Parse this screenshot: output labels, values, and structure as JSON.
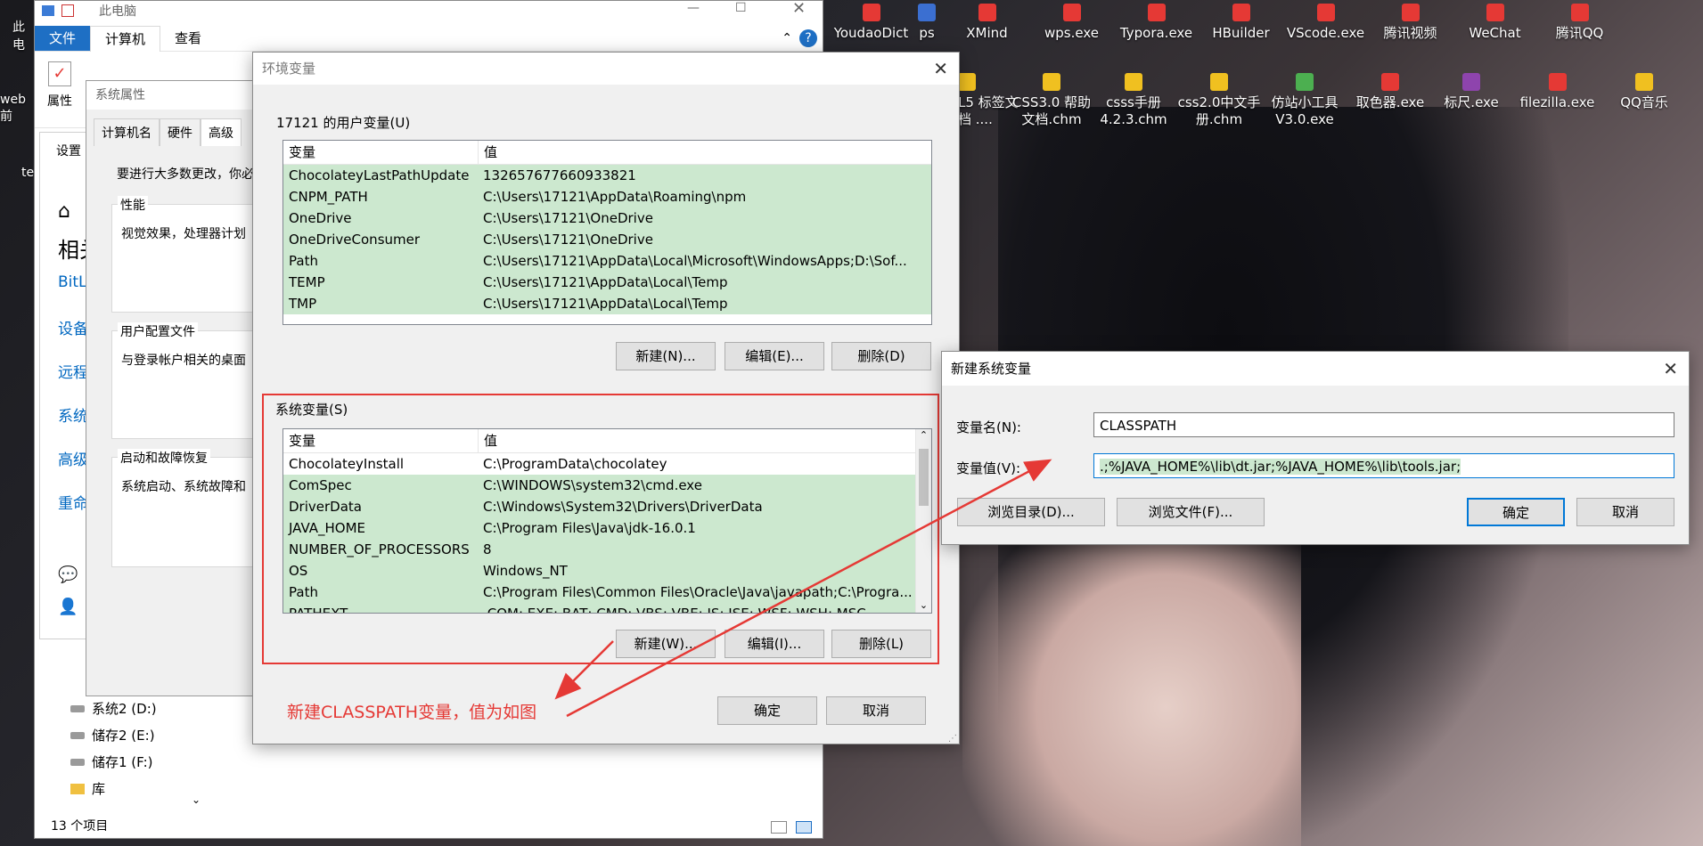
{
  "desktop": {
    "icons": [
      {
        "label": "YoudaoDict",
        "color": "#e53935"
      },
      {
        "label": "ps",
        "color": "#3b6fd1"
      },
      {
        "label": "XMind",
        "color": "#e53935"
      },
      {
        "label": "wps.exe",
        "color": "#e53935"
      },
      {
        "label": "Typora.exe",
        "color": "#e53935"
      },
      {
        "label": "HBuilder",
        "color": "#e53935"
      },
      {
        "label": "VScode.exe",
        "color": "#e53935"
      },
      {
        "label": "腾讯视频",
        "color": "#e53935"
      },
      {
        "label": "WeChat",
        "color": "#e53935"
      },
      {
        "label": "腾讯QQ",
        "color": "#e53935"
      }
    ],
    "icons_row2": [
      {
        "label": "L5 标签文档 ....",
        "color": "#f0c020"
      },
      {
        "label": "CSS3.0 帮助文档.chm",
        "color": "#f0c020"
      },
      {
        "label": "csss手册4.2.3.chm",
        "color": "#f0c020"
      },
      {
        "label": "css2.0中文手册.chm",
        "color": "#f0c020"
      },
      {
        "label": "仿站小工具V3.0.exe",
        "color": "#4caf50"
      },
      {
        "label": "取色器.exe",
        "color": "#e53935"
      },
      {
        "label": "标尺.exe",
        "color": "#8e44ad"
      },
      {
        "label": "filezilla.exe",
        "color": "#e53935"
      },
      {
        "label": "QQ音乐",
        "color": "#f0c020"
      }
    ],
    "left_labels": [
      "此电",
      "web前",
      "te"
    ]
  },
  "explorer": {
    "title": "此电脑",
    "tabs": [
      "文件",
      "计算机",
      "查看"
    ],
    "ribbon_button": "属性",
    "nav": [
      "系统2 (D:)",
      "储存2 (E:)",
      "储存1 (F:)",
      "库"
    ],
    "status": "13 个项目"
  },
  "settings": {
    "label": "设置",
    "items": [
      "相关",
      "BitLo",
      "设备",
      "远程",
      "系统",
      "高级",
      "重命"
    ]
  },
  "sysprops": {
    "title": "系统属性",
    "tabs": [
      "计算机名",
      "硬件",
      "高级"
    ],
    "intro": "要进行大多数更改，你必",
    "groups": [
      {
        "label": "性能",
        "text": "视觉效果，处理器计划"
      },
      {
        "label": "用户配置文件",
        "text": "与登录帐户相关的桌面"
      },
      {
        "label": "启动和故障恢复",
        "text": "系统启动、系统故障和"
      }
    ]
  },
  "env": {
    "title": "环境变量",
    "user_label": "17121 的用户变量(U)",
    "col_var": "变量",
    "col_val": "值",
    "user_vars": [
      {
        "name": "ChocolateyLastPathUpdate",
        "value": "132657677660933821"
      },
      {
        "name": "CNPM_PATH",
        "value": "C:\\Users\\17121\\AppData\\Roaming\\npm"
      },
      {
        "name": "OneDrive",
        "value": "C:\\Users\\17121\\OneDrive"
      },
      {
        "name": "OneDriveConsumer",
        "value": "C:\\Users\\17121\\OneDrive"
      },
      {
        "name": "Path",
        "value": "C:\\Users\\17121\\AppData\\Local\\Microsoft\\WindowsApps;D:\\Sof..."
      },
      {
        "name": "TEMP",
        "value": "C:\\Users\\17121\\AppData\\Local\\Temp"
      },
      {
        "name": "TMP",
        "value": "C:\\Users\\17121\\AppData\\Local\\Temp"
      }
    ],
    "user_buttons": [
      "新建(N)...",
      "编辑(E)...",
      "删除(D)"
    ],
    "sys_label": "系统变量(S)",
    "sys_vars": [
      {
        "name": "ChocolateyInstall",
        "value": "C:\\ProgramData\\chocolatey"
      },
      {
        "name": "ComSpec",
        "value": "C:\\WINDOWS\\system32\\cmd.exe"
      },
      {
        "name": "DriverData",
        "value": "C:\\Windows\\System32\\Drivers\\DriverData"
      },
      {
        "name": "JAVA_HOME",
        "value": "C:\\Program Files\\Java\\jdk-16.0.1"
      },
      {
        "name": "NUMBER_OF_PROCESSORS",
        "value": "8"
      },
      {
        "name": "OS",
        "value": "Windows_NT"
      },
      {
        "name": "Path",
        "value": "C:\\Program Files\\Common Files\\Oracle\\Java\\javapath;C:\\Progra..."
      },
      {
        "name": "PATHEXT",
        "value": ".COM;.EXE;.BAT;.CMD;.VBS;.VBE;.JS;.JSE;.WSF;.WSH;.MSC"
      }
    ],
    "sys_buttons": [
      "新建(W)...",
      "编辑(I)...",
      "删除(L)"
    ],
    "ok": "确定",
    "cancel": "取消",
    "annotation": "新建CLASSPATH变量，值为如图"
  },
  "newvar": {
    "title": "新建系统变量",
    "name_label": "变量名(N):",
    "name_value": "CLASSPATH",
    "value_label": "变量值(V):",
    "value_value": ".;%JAVA_HOME%\\lib\\dt.jar;%JAVA_HOME%\\lib\\tools.jar;",
    "browse_dir": "浏览目录(D)...",
    "browse_file": "浏览文件(F)...",
    "ok": "确定",
    "cancel": "取消"
  },
  "colors": {
    "accent": "#0078d7",
    "highlight": "#cce8cf",
    "annotation": "#e53935",
    "file_tab": "#1e6fc4"
  }
}
